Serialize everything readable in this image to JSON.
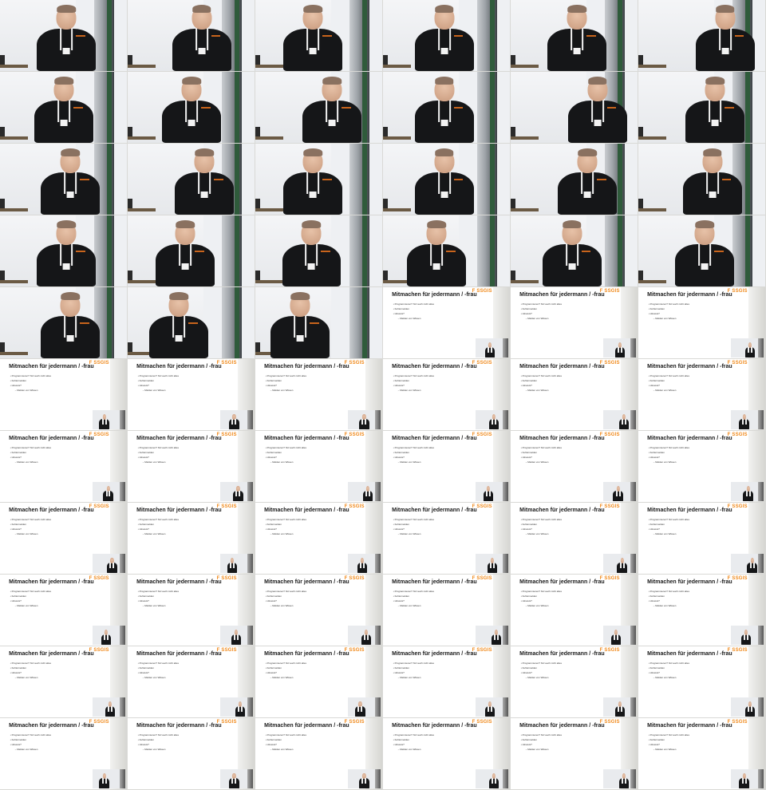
{
  "grid": {
    "columns": 6,
    "rows": 11,
    "frame_count": 66,
    "speaker_frames": 27
  },
  "slide": {
    "brand": "F SSGIS",
    "title": "Mitmachen für jedermann / -frau",
    "bullets": [
      {
        "text": "Programmieren? Nö! auch nicht alles",
        "level": 1
      },
      {
        "text": "Fehlermelden",
        "level": 1
      },
      {
        "text": "Hinweis?",
        "level": 1
      },
      {
        "text": "Melden von Wissen",
        "level": 2
      }
    ]
  },
  "colors": {
    "brand_orange": "#f08a1c",
    "shirt": "#151618",
    "background": "#d9d9d6"
  }
}
